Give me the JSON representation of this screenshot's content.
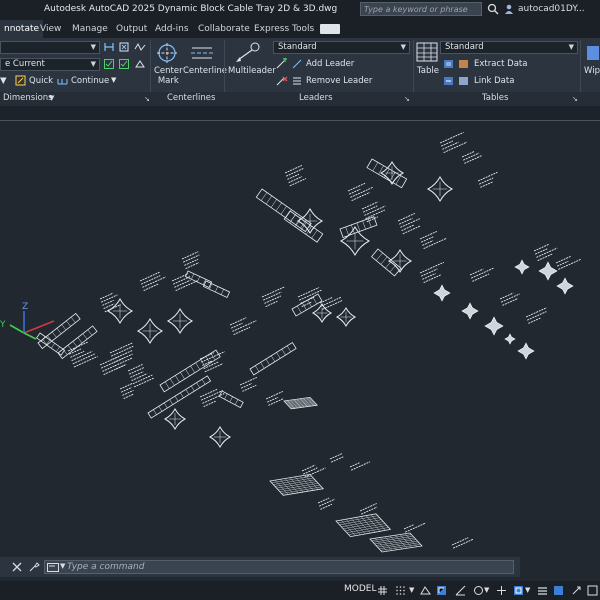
{
  "title_bar": {
    "title": "Autodesk AutoCAD 2025    Dynamic Block Cable Tray 2D & 3D.dwg",
    "search_placeholder": "Type a keyword or phrase",
    "user": "autocad01DY..."
  },
  "ribbon_tabs": [
    {
      "label": "nnotate",
      "active": true
    },
    {
      "label": "View",
      "active": false
    },
    {
      "label": "Manage",
      "active": false
    },
    {
      "label": "Output",
      "active": false
    },
    {
      "label": "Add-ins",
      "active": false
    },
    {
      "label": "Collaborate",
      "active": false
    },
    {
      "label": "Express Tools",
      "active": false
    }
  ],
  "ribbon": {
    "dimensions": {
      "style_value": "",
      "layer_value": "e Current",
      "quick_label": "Quick",
      "continue_label": "Continue",
      "panel_label": "Dimensions"
    },
    "centerlines": {
      "center_mark_label": "Center\nMark",
      "centerline_label": "Centerline",
      "panel_label": "Centerlines"
    },
    "leaders": {
      "multileader_label": "Multileader",
      "style_value": "Standard",
      "add_leader_label": "Add Leader",
      "remove_leader_label": "Remove Leader",
      "panel_label": "Leaders"
    },
    "tables": {
      "table_label": "Table",
      "style_value": "Standard",
      "extract_data_label": "Extract Data",
      "link_data_label": "Link Data",
      "panel_label": "Tables"
    },
    "wipe_label": "Wip"
  },
  "ucs": {
    "x_label": "Y",
    "z_label": "Z"
  },
  "command_line": {
    "placeholder": "Type a command"
  },
  "status_bar": {
    "model_label": "MODEL"
  },
  "colors": {
    "background": "#212830",
    "ribbon": "#2c3440",
    "titlebar": "#1b2027",
    "drawing_lines": "#e8ecf0",
    "ucs_x": "#d23a3a",
    "ucs_y": "#3ccf4a",
    "ucs_z": "#3a6fe0"
  }
}
